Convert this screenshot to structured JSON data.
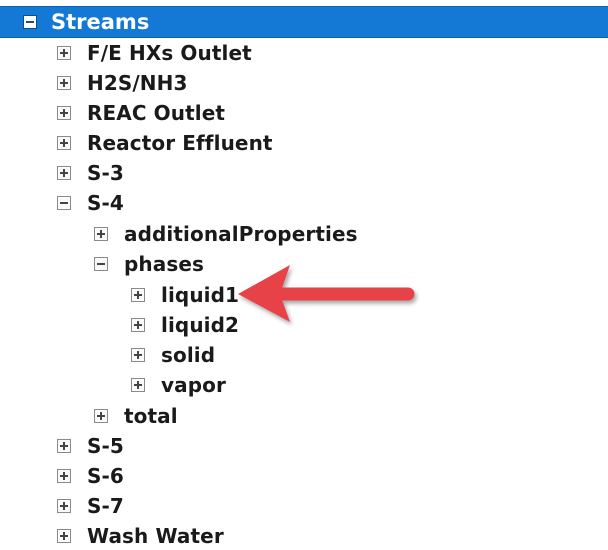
{
  "tree": {
    "root": {
      "label": "Streams",
      "state": "expanded",
      "selected": true
    },
    "nodes": [
      {
        "label": "F/E HXs Outlet",
        "state": "collapsed",
        "depth": 1
      },
      {
        "label": "H2S/NH3",
        "state": "collapsed",
        "depth": 1
      },
      {
        "label": "REAC Outlet",
        "state": "collapsed",
        "depth": 1
      },
      {
        "label": "Reactor Effluent",
        "state": "collapsed",
        "depth": 1
      },
      {
        "label": "S-3",
        "state": "collapsed",
        "depth": 1
      },
      {
        "label": "S-4",
        "state": "expanded",
        "depth": 1
      },
      {
        "label": "additionalProperties",
        "state": "collapsed",
        "depth": 2
      },
      {
        "label": "phases",
        "state": "expanded",
        "depth": 2
      },
      {
        "label": "liquid1",
        "state": "collapsed",
        "depth": 3
      },
      {
        "label": "liquid2",
        "state": "collapsed",
        "depth": 3
      },
      {
        "label": "solid",
        "state": "collapsed",
        "depth": 3
      },
      {
        "label": "vapor",
        "state": "collapsed",
        "depth": 3
      },
      {
        "label": "total",
        "state": "collapsed",
        "depth": 2
      },
      {
        "label": "S-5",
        "state": "collapsed",
        "depth": 1
      },
      {
        "label": "S-6",
        "state": "collapsed",
        "depth": 1
      },
      {
        "label": "S-7",
        "state": "collapsed",
        "depth": 1
      },
      {
        "label": "Wash Water",
        "state": "collapsed",
        "depth": 1
      }
    ]
  },
  "annotation": {
    "arrow_target": "liquid1",
    "arrow_color": "#e8434a"
  },
  "colors": {
    "selection": "#1479d4",
    "text": "#1a1a1a",
    "selection_text": "#ffffff"
  }
}
